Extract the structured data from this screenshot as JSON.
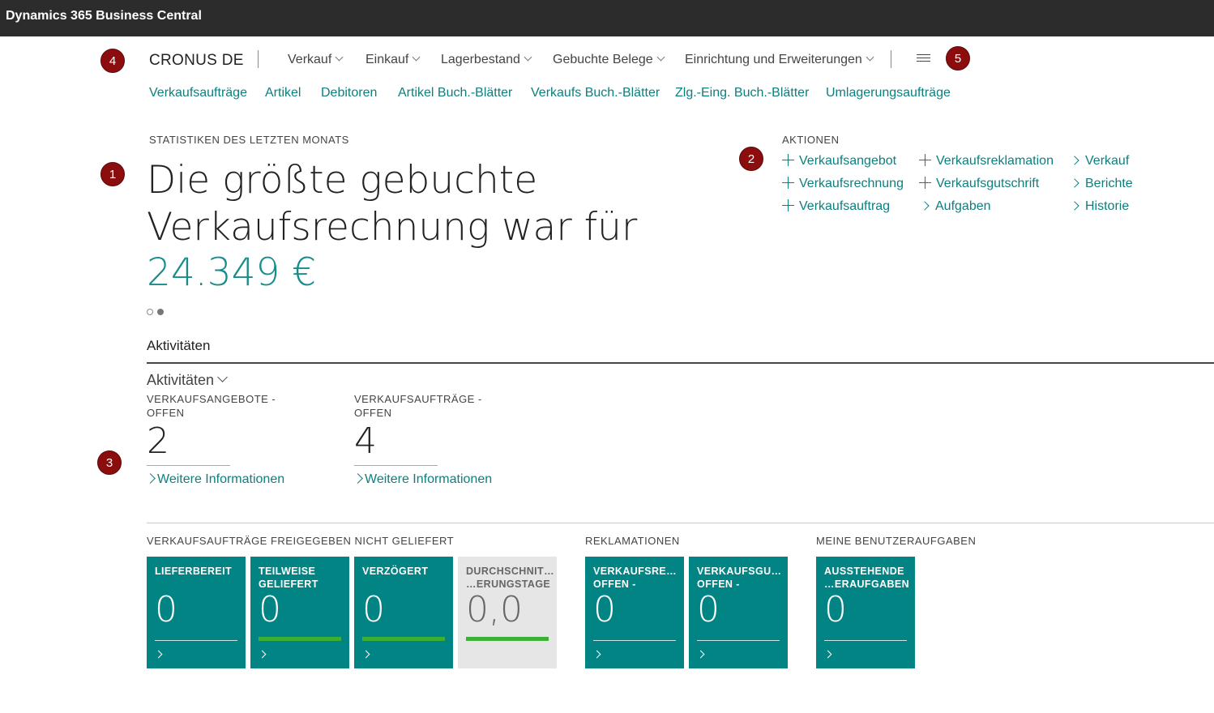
{
  "window": {
    "title": "Dynamics 365 Business Central"
  },
  "markers": [
    "1",
    "2",
    "3",
    "4",
    "5"
  ],
  "header": {
    "company": "CRONUS DE",
    "nav": [
      "Verkauf",
      "Einkauf",
      "Lagerbestand",
      "Gebuchte Belege",
      "Einrichtung und Erweiterungen"
    ],
    "menu_icon": "hamburger-menu-icon"
  },
  "quick_links": [
    "Verkaufsaufträge",
    "Artikel",
    "Debitoren",
    "Artikel Buch.-Blätter",
    "Verkaufs Buch.-Blätter",
    "Zlg.-Eing. Buch.-Blätter",
    "Umlagerungsaufträge"
  ],
  "headline": {
    "caption": "STATISTIKEN DES LETZTEN MONATS",
    "text": "Die größte gebuchte Verkaufsrechnung war für",
    "amount": "24.349 €",
    "pages": 2,
    "active_page": 2
  },
  "actions": {
    "caption": "AKTIONEN",
    "col1": [
      "Verkaufsangebot",
      "Verkaufsrechnung",
      "Verkaufsauftrag"
    ],
    "col2_new": [
      "Verkaufsreklamation",
      "Verkaufsgutschrift"
    ],
    "col2_menu": [
      "Aufgaben"
    ],
    "col3_menu": [
      "Verkauf",
      "Berichte",
      "Historie"
    ]
  },
  "activities": {
    "section_title": "Aktivitäten",
    "group_title": "Aktivitäten",
    "cues": [
      {
        "label": "VERKAUFSANGEBOTE -\nOFFEN",
        "value": "2",
        "link": "Weitere Informationen"
      },
      {
        "label": "VERKAUFSAUFTRÄGE -\nOFFEN",
        "value": "4",
        "link": "Weitere Informationen"
      }
    ]
  },
  "tile_groups": [
    {
      "title": "VERKAUFSAUFTRÄGE FREIGEGEBEN NICHT GELIEFERT",
      "tiles": [
        {
          "label": "LIEFERBEREIT",
          "value": "0",
          "bar": false,
          "grey": false
        },
        {
          "label": "TEILWEISE\nGELIEFERT",
          "value": "0",
          "bar": true,
          "grey": false
        },
        {
          "label": "VERZÖGERT",
          "value": "0",
          "bar": true,
          "grey": false
        },
        {
          "label": "DURCHSCHNIT…\n…ERUNGSTAGE",
          "value": "0,0",
          "bar": true,
          "grey": true
        }
      ]
    },
    {
      "title": "REKLAMATIONEN",
      "tiles": [
        {
          "label": "VERKAUFSRE…\nOFFEN -",
          "value": "0",
          "bar": false,
          "grey": false
        },
        {
          "label": "VERKAUFSGU…\nOFFEN -",
          "value": "0",
          "bar": false,
          "grey": false
        }
      ]
    },
    {
      "title": "MEINE BENUTZERAUFGABEN",
      "tiles": [
        {
          "label": "AUSSTEHENDE\n…ERAUFGABEN",
          "value": "0",
          "bar": false,
          "grey": false
        }
      ]
    }
  ],
  "colors": {
    "teal": "#028484",
    "link": "#0d7f7f",
    "marker": "#8b0d0d",
    "bar_green": "#3cb034"
  }
}
